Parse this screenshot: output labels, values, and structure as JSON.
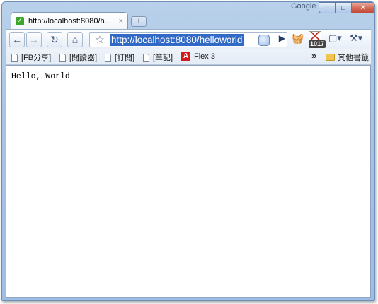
{
  "titlebar": {
    "brand": "Google",
    "minimize": "–",
    "maximize": "□",
    "close": "✕"
  },
  "tab": {
    "title": "http://localhost:8080/h...",
    "close": "×",
    "favicon": "check-favicon-icon"
  },
  "new_tab": "+",
  "toolbar": {
    "back": "←",
    "forward": "→",
    "reload": "↻",
    "home": "⌂",
    "star": "☆",
    "url": "http://localhost:8080/helloworld",
    "go": "▶",
    "page_menu": "▢▾",
    "tools_menu": "⚒▾",
    "gmail_count": "1017"
  },
  "bookmarks": {
    "items": [
      "[FB分享]",
      "[閱讀器]",
      "[訂閱]",
      "[筆記]",
      "Flex 3"
    ],
    "overflow": "»",
    "other": "其他書籤"
  },
  "page": {
    "text": "Hello, World"
  }
}
